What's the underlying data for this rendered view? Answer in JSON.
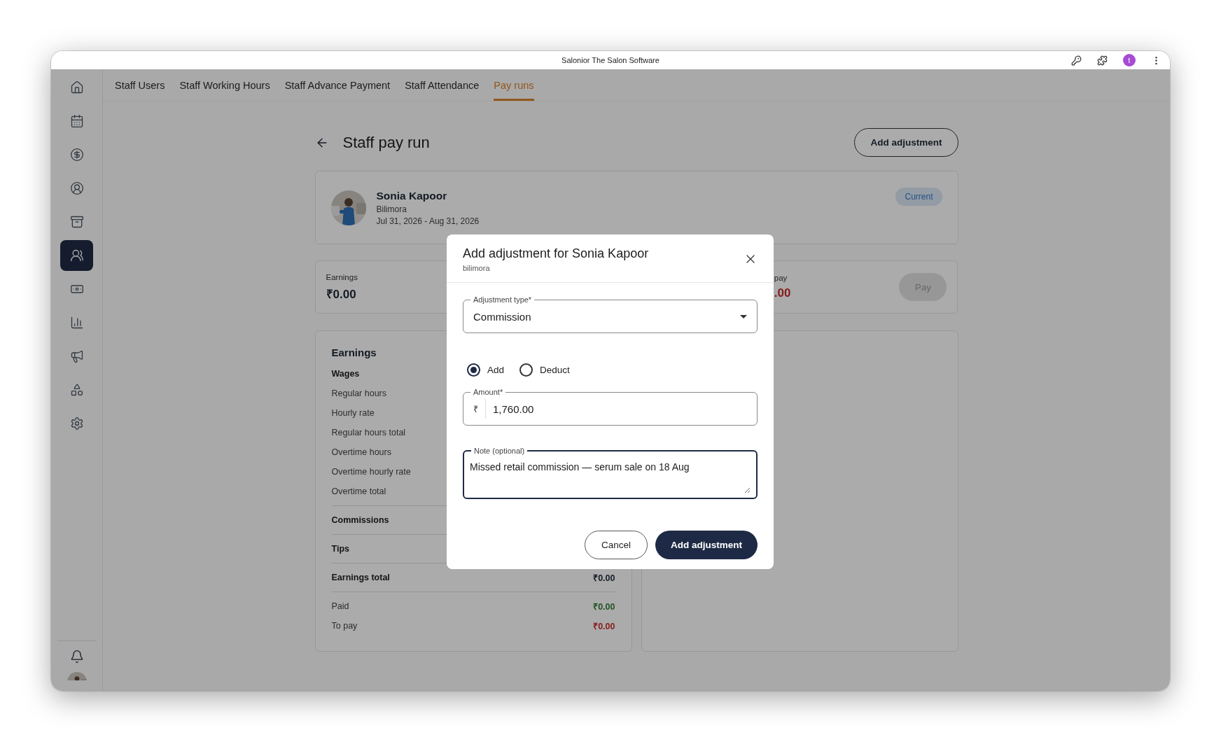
{
  "window": {
    "title": "Salonior The Salon Software",
    "avatar_letter": "t"
  },
  "sidebar": {
    "items": [
      {
        "selected": false
      },
      {
        "selected": false
      },
      {
        "selected": false
      },
      {
        "selected": false
      },
      {
        "selected": false
      },
      {
        "selected": true
      },
      {
        "selected": false
      },
      {
        "selected": false
      },
      {
        "selected": false
      },
      {
        "selected": false
      },
      {
        "selected": false
      }
    ]
  },
  "tabs": [
    {
      "label": "Staff Users",
      "selected": false
    },
    {
      "label": "Staff Working Hours",
      "selected": false
    },
    {
      "label": "Staff Advance Payment",
      "selected": false
    },
    {
      "label": "Staff Attendance",
      "selected": false
    },
    {
      "label": "Pay runs",
      "selected": true
    }
  ],
  "page": {
    "title": "Staff pay run",
    "action": "Add adjustment"
  },
  "staff": {
    "name": "Sonia Kapoor",
    "location": "Bilimora",
    "period": "Jul 31, 2026 - Aug 31, 2026",
    "status": "Current"
  },
  "summary": {
    "earnings": {
      "label": "Earnings",
      "value": "₹0.00"
    },
    "to_pay": {
      "label": "pay",
      "value": ".00",
      "color": "#851b1b"
    },
    "pay_button": {
      "label": "Pay",
      "disabled": true
    }
  },
  "earnings": {
    "title": "Earnings",
    "sections": [
      {
        "rows": [
          {
            "kind": "heading",
            "label": "Wages"
          },
          {
            "kind": "item",
            "label": "Regular hours"
          },
          {
            "kind": "item",
            "label": "Hourly rate"
          },
          {
            "kind": "item",
            "label": "Regular hours total"
          },
          {
            "kind": "item",
            "label": "Overtime hours"
          },
          {
            "kind": "item",
            "label": "Overtime hourly rate"
          },
          {
            "kind": "item",
            "label": "Overtime total"
          }
        ]
      },
      {
        "rows": [
          {
            "kind": "heading",
            "label": "Commissions"
          }
        ]
      },
      {
        "rows": [
          {
            "kind": "heading",
            "label": "Tips"
          }
        ]
      },
      {
        "rows": [
          {
            "kind": "heading",
            "label": "Earnings total",
            "value": "₹0.00"
          }
        ]
      },
      {
        "rows": [
          {
            "kind": "item",
            "label": "Paid",
            "value": "₹0.00",
            "color": "#1f5422"
          },
          {
            "kind": "item",
            "label": "To pay",
            "value": "₹0.00",
            "color": "#851b1b"
          }
        ]
      }
    ]
  },
  "modal": {
    "title": "Add adjustment for Sonia Kapoor",
    "subtitle": "bilimora",
    "type_field": {
      "label": "Adjustment type*",
      "value": "Commission"
    },
    "direction": [
      {
        "label": "Add",
        "selected": true
      },
      {
        "label": "Deduct",
        "selected": false
      }
    ],
    "amount_field": {
      "label": "Amount*",
      "prefix": "₹",
      "value": "1,760.00"
    },
    "note_field": {
      "label": "Note (optional)",
      "value": "Missed retail commission — serum sale on 18 Aug",
      "focused": true
    },
    "cancel": "Cancel",
    "submit": "Add adjustment"
  }
}
